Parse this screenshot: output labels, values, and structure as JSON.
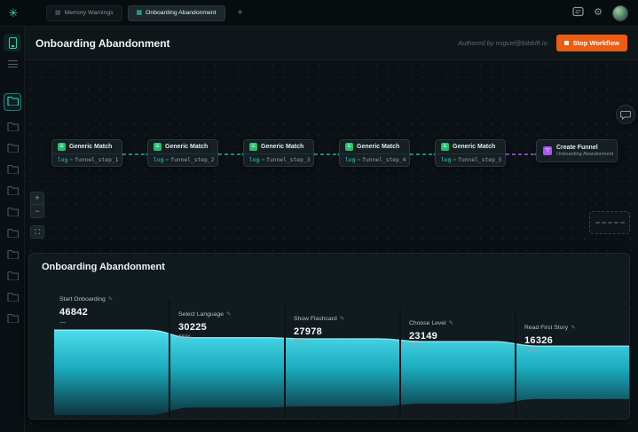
{
  "topbar": {
    "tabs": [
      {
        "label": "Memory Warnings",
        "active": false
      },
      {
        "label": "Onboarding Abandonment",
        "active": true
      }
    ],
    "new_tab_label": "+"
  },
  "workflow_header": {
    "title": "Onboarding Abandonment",
    "authored_by": "Authored by miguel@bitdrift.io",
    "stop_button_label": "Stop Workflow"
  },
  "workflow": {
    "nodes": [
      {
        "kind": "match",
        "title": "Generic Match",
        "field": "log",
        "operator": "=",
        "value": "funnel_step_1"
      },
      {
        "kind": "match",
        "title": "Generic Match",
        "field": "log",
        "operator": "=",
        "value": "funnel_step_2"
      },
      {
        "kind": "match",
        "title": "Generic Match",
        "field": "log",
        "operator": "=",
        "value": "funnel_step_3"
      },
      {
        "kind": "match",
        "title": "Generic Match",
        "field": "log",
        "operator": "=",
        "value": "funnel_step_4"
      },
      {
        "kind": "match",
        "title": "Generic Match",
        "field": "log",
        "operator": "=",
        "value": "funnel_step_5"
      },
      {
        "kind": "funnel",
        "title": "Create Funnel",
        "subtitle": "Onboarding Abandonment"
      }
    ]
  },
  "canvas_controls": {
    "zoom_in": "+",
    "zoom_out": "−",
    "fit": "⛶"
  },
  "icons": {
    "logo": "✳",
    "tab": "▦",
    "settings_gear": "⚙",
    "edit_pencil": "✎",
    "match": "☰",
    "funnel": "▽"
  },
  "colors": {
    "accent_teal": "#2dd4bf",
    "edge_teal": "#14b8a6",
    "edge_purple": "#a855f7",
    "node_green": "#1fc16b",
    "node_purple": "#a855f7",
    "stop_orange": "#ed5c13"
  },
  "sidebar": {
    "folder_count": 11,
    "active_folder_index": 0
  },
  "chart_data": {
    "type": "funnel",
    "title": "Onboarding Abandonment",
    "stages": [
      {
        "label": "Start Onboarding",
        "value": 46842,
        "conversion": "—"
      },
      {
        "label": "Select Language",
        "value": 30225,
        "conversion": "65%"
      },
      {
        "label": "Show Flashcard",
        "value": 27978,
        "conversion": "93%"
      },
      {
        "label": "Choose Level",
        "value": 23149,
        "conversion": "83%"
      },
      {
        "label": "Read First Story",
        "value": 16326,
        "conversion": "71%"
      }
    ],
    "colors": {
      "area_top": "#52e7f7",
      "area_mid": "#1cc0d4",
      "area_bottom": "#0b3a45",
      "edge_highlight": "#c9f8ff"
    }
  }
}
